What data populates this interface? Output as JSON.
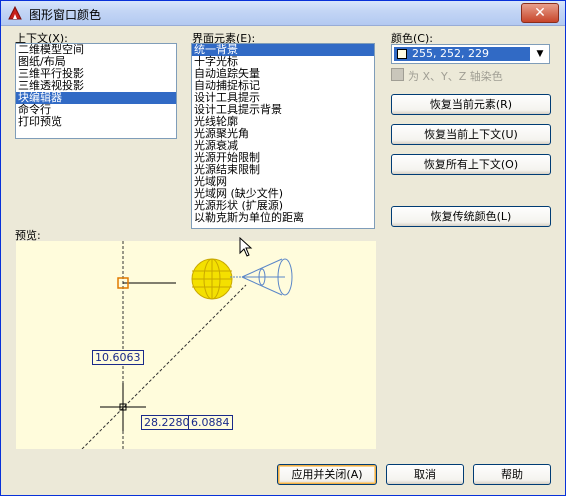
{
  "window": {
    "title": "图形窗口颜色",
    "close_glyph": "✕"
  },
  "context": {
    "label": "上下文(X):",
    "items": [
      {
        "label": "二维模型空间",
        "selected": false
      },
      {
        "label": "图纸/布局",
        "selected": false
      },
      {
        "label": "三维平行投影",
        "selected": false
      },
      {
        "label": "三维透视投影",
        "selected": false
      },
      {
        "label": "块编辑器",
        "selected": true
      },
      {
        "label": "命令行",
        "selected": false
      },
      {
        "label": "打印预览",
        "selected": false
      }
    ]
  },
  "elements": {
    "label": "界面元素(E):",
    "items": [
      {
        "label": "统一背景",
        "selected": true
      },
      {
        "label": "十字光标",
        "selected": false
      },
      {
        "label": "自动追踪矢量",
        "selected": false
      },
      {
        "label": "自动捕捉标记",
        "selected": false
      },
      {
        "label": "设计工具提示",
        "selected": false
      },
      {
        "label": "设计工具提示背景",
        "selected": false
      },
      {
        "label": "光线轮廓",
        "selected": false
      },
      {
        "label": "光源聚光角",
        "selected": false
      },
      {
        "label": "光源衰减",
        "selected": false
      },
      {
        "label": "光源开始限制",
        "selected": false
      },
      {
        "label": "光源结束限制",
        "selected": false
      },
      {
        "label": "光域网",
        "selected": false
      },
      {
        "label": "光域网 (缺少文件)",
        "selected": false
      },
      {
        "label": "光源形状 (扩展源)",
        "selected": false
      },
      {
        "label": "以勒克斯为单位的距离",
        "selected": false
      }
    ]
  },
  "color": {
    "label": "颜色(C):",
    "value": "255, 252, 229",
    "swatch_color": "#fffce5",
    "arrow_glyph": "▼",
    "tint_label": "为 X、Y、Z 轴染色"
  },
  "buttons": {
    "restore_element": "恢复当前元素(R)",
    "restore_context": "恢复当前上下文(U)",
    "restore_all": "恢复所有上下文(O)",
    "restore_classic": "恢复传统颜色(L)",
    "apply_close": "应用并关闭(A)",
    "cancel": "取消",
    "help": "帮助"
  },
  "preview": {
    "label": "预览:",
    "dim_vertical": "10.6063",
    "coord_x": "28.2280",
    "coord_y": "6.0884",
    "background_color": "#fffcdc"
  }
}
